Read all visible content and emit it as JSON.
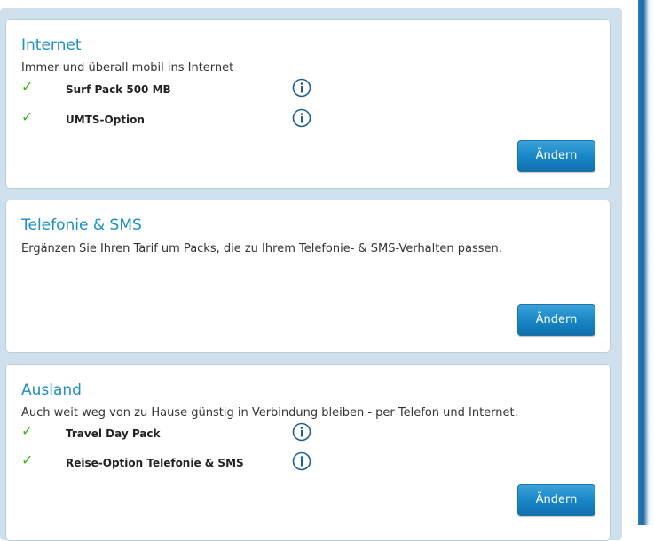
{
  "sections": [
    {
      "title": "Internet",
      "description": "Immer und überall mobil ins Internet",
      "items": [
        {
          "label": "Surf Pack 500 MB",
          "checked": true,
          "icon": "info-icon"
        },
        {
          "label": "UMTS-Option",
          "checked": true,
          "icon": "info-icon"
        }
      ],
      "button_label": "Ändern"
    },
    {
      "title": "Telefonie & SMS",
      "description": "Ergänzen Sie Ihren Tarif um Packs, die zu Ihrem Telefonie- & SMS-Verhalten passen.",
      "items": [],
      "button_label": "Ändern"
    },
    {
      "title": "Ausland",
      "description": "Auch weit weg von zu Hause günstig in Verbindung bleiben - per Telefon und Internet.",
      "items": [
        {
          "label": "Travel Day Pack",
          "checked": true,
          "icon": "info-icon"
        },
        {
          "label": "Reise-Option Telefonie & SMS",
          "checked": true,
          "icon": "info-icon"
        }
      ],
      "button_label": "Ändern"
    }
  ],
  "colors": {
    "title": "#1b8ec2",
    "check": "#3cb424",
    "button": "#1784c5",
    "panel": "#cfe0ec"
  }
}
